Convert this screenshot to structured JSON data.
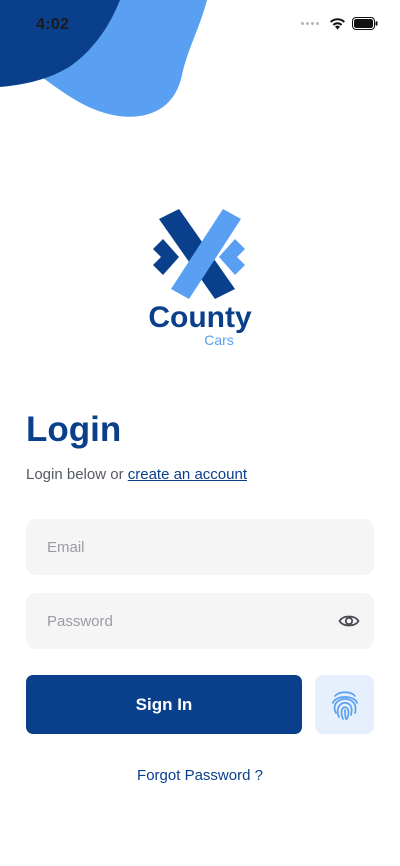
{
  "status_bar": {
    "time": "4:02"
  },
  "logo": {
    "name": "County",
    "sub": "Cars"
  },
  "login": {
    "title": "Login",
    "subtitle_prefix": "Login below or ",
    "create_account_link": "create an account",
    "email_placeholder": "Email",
    "password_placeholder": "Password",
    "signin_label": "Sign In",
    "forgot_label": "Forgot Password ?"
  },
  "colors": {
    "primary": "#0a3f8c",
    "accent": "#5aa0f2",
    "field_bg": "#f5f5f6",
    "fingerprint_bg": "#e6f0fd"
  },
  "icons": {
    "show_password": "eye-icon",
    "biometric": "fingerprint-icon"
  }
}
